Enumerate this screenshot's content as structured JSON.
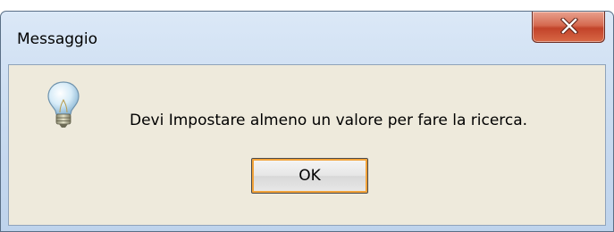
{
  "window": {
    "title": "Messaggio"
  },
  "dialog": {
    "icon": "lightbulb-icon",
    "message": "Devi Impostare almeno un valore per fare la ricerca.",
    "ok_label": "OK"
  },
  "colors": {
    "close_button": "#c2432a",
    "ok_focus_ring": "#f2a33a",
    "client_background": "#eeeadc",
    "titlebar": "#c9dbf0"
  }
}
